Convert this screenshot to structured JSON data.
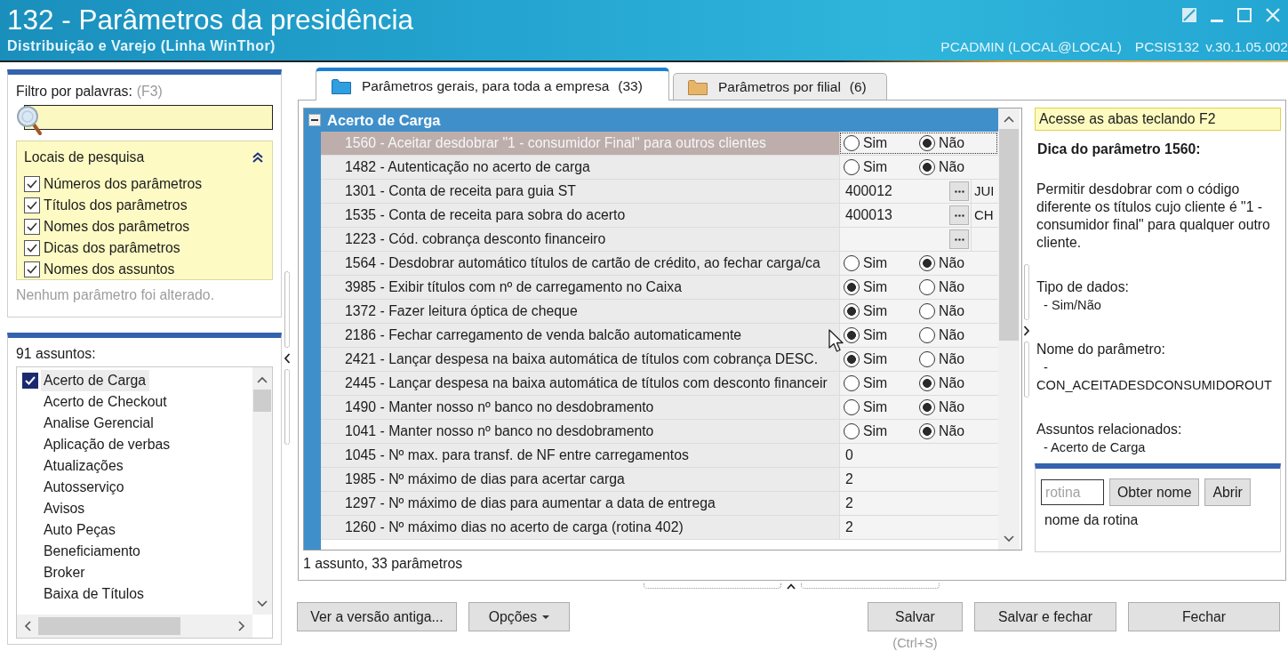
{
  "window": {
    "title": "132 - Parâmetros da presidência",
    "subtitle": "Distribuição e Varejo (Linha WinThor)",
    "user": "PCADMIN (LOCAL@LOCAL)",
    "routine": "PCSIS132",
    "version": "v.30.1.05.002"
  },
  "filter": {
    "label": "Filtro por palavras:",
    "shortcut": "(F3)",
    "search_locations": {
      "title": "Locais de pesquisa",
      "expanded": true,
      "options": [
        {
          "label": "Números dos parâmetros",
          "checked": true
        },
        {
          "label": "Títulos dos parâmetros",
          "checked": true
        },
        {
          "label": "Nomes dos parâmetros",
          "checked": true
        },
        {
          "label": "Dicas dos parâmetros",
          "checked": true
        },
        {
          "label": "Nomes dos assuntos",
          "checked": true
        }
      ]
    },
    "status": "Nenhum parâmetro foi alterado."
  },
  "subjects": {
    "count_label": "91 assuntos:",
    "items": [
      {
        "label": "Acerto de Carga",
        "checked": true,
        "selected": true
      },
      {
        "label": "Acerto de Checkout",
        "checked": false,
        "selected": false
      },
      {
        "label": "Analise Gerencial",
        "checked": false,
        "selected": false
      },
      {
        "label": "Aplicação de verbas",
        "checked": false,
        "selected": false
      },
      {
        "label": "Atualizações",
        "checked": false,
        "selected": false
      },
      {
        "label": "Autosserviço",
        "checked": false,
        "selected": false
      },
      {
        "label": "Avisos",
        "checked": false,
        "selected": false
      },
      {
        "label": "Auto Peças",
        "checked": false,
        "selected": false
      },
      {
        "label": "Beneficiamento",
        "checked": false,
        "selected": false
      },
      {
        "label": "Broker",
        "checked": false,
        "selected": false
      },
      {
        "label": "Baixa de Títulos",
        "checked": false,
        "selected": false
      }
    ]
  },
  "tabs": [
    {
      "label": "Parâmetros gerais, para toda a empresa",
      "count": "(33)",
      "selected": true
    },
    {
      "label": "Parâmetros por filial",
      "count": "(6)",
      "selected": false
    }
  ],
  "grid": {
    "group": {
      "title": "Acerto de Carga",
      "expanded": true
    },
    "rows": [
      {
        "label": "1560 - Aceitar desdobrar \"1 - consumidor Final\" para outros clientes",
        "selected": true,
        "kind": "radio",
        "options": [
          {
            "label": "Sim",
            "selected": false
          },
          {
            "label": "Não",
            "selected": true
          }
        ]
      },
      {
        "label": "1482 - Autenticação no acerto de carga",
        "selected": false,
        "kind": "radio",
        "options": [
          {
            "label": "Sim",
            "selected": false
          },
          {
            "label": "Não",
            "selected": true
          }
        ]
      },
      {
        "label": "1301 - Conta de receita para guia ST",
        "selected": false,
        "kind": "lookup",
        "value": "400012",
        "description": "JUI"
      },
      {
        "label": "1535 - Conta de receita para sobra do acerto",
        "selected": false,
        "kind": "lookup",
        "value": "400013",
        "description": "CH"
      },
      {
        "label": "1223 - Cód. cobrança desconto financeiro",
        "selected": false,
        "kind": "lookup"
      },
      {
        "label": "1564 - Desdobrar automático títulos de cartão de crédito, ao fechar carga/ca",
        "selected": false,
        "kind": "radio",
        "options": [
          {
            "label": "Sim",
            "selected": false
          },
          {
            "label": "Não",
            "selected": true
          }
        ]
      },
      {
        "label": "3985 - Exibir títulos com nº de carregamento no Caixa",
        "selected": false,
        "kind": "radio",
        "options": [
          {
            "label": "Sim",
            "selected": true
          },
          {
            "label": "Não",
            "selected": false
          }
        ]
      },
      {
        "label": "1372 - Fazer leitura óptica de cheque",
        "selected": false,
        "kind": "radio",
        "options": [
          {
            "label": "Sim",
            "selected": true
          },
          {
            "label": "Não",
            "selected": false
          }
        ]
      },
      {
        "label": "2186 - Fechar carregamento de venda balcão automaticamente",
        "selected": false,
        "kind": "radio",
        "options": [
          {
            "label": "Sim",
            "selected": true
          },
          {
            "label": "Não",
            "selected": false
          }
        ]
      },
      {
        "label": "2421 - Lançar despesa na baixa automática de títulos com cobrança DESC.",
        "selected": false,
        "kind": "radio",
        "options": [
          {
            "label": "Sim",
            "selected": true
          },
          {
            "label": "Não",
            "selected": false
          }
        ]
      },
      {
        "label": "2445 - Lançar despesa na baixa automática de títulos com desconto financeir",
        "selected": false,
        "kind": "radio",
        "options": [
          {
            "label": "Sim",
            "selected": false
          },
          {
            "label": "Não",
            "selected": true
          }
        ]
      },
      {
        "label": "1490 - Manter nosso nº banco no desdobramento",
        "selected": false,
        "kind": "radio",
        "options": [
          {
            "label": "Sim",
            "selected": false
          },
          {
            "label": "Não",
            "selected": true
          }
        ]
      },
      {
        "label": "1041 - Manter nosso nº banco no desdobramento",
        "selected": false,
        "kind": "radio",
        "options": [
          {
            "label": "Sim",
            "selected": false
          },
          {
            "label": "Não",
            "selected": true
          }
        ]
      },
      {
        "label": "1045 - Nº max. para transf. de NF entre carregamentos",
        "selected": false,
        "kind": "number",
        "value": "0"
      },
      {
        "label": "1985 - Nº máximo de dias para acertar carga",
        "selected": false,
        "kind": "number",
        "value": "2"
      },
      {
        "label": "1297 - Nº máximo de dias para aumentar a data de entrega",
        "selected": false,
        "kind": "number",
        "value": "2"
      },
      {
        "label": "1260 - Nº máximo dias no acerto de carga (rotina 402)",
        "selected": false,
        "kind": "number",
        "value": "2"
      }
    ],
    "summary": "1 assunto, 33 parâmetros"
  },
  "help": {
    "tip": "Acesse as abas teclando F2",
    "heading": "Dica do parâmetro 1560:",
    "description": "Permitir desdobrar com o código diferente os títulos cujo cliente é \"1 - consumidor final\" para qualquer outro cliente.",
    "sections": [
      {
        "title": "Tipo de dados:",
        "value": "- Sim/Não"
      },
      {
        "title": "Nome do parâmetro:",
        "value": "- CON_ACEITADESDCONSUMIDOROUT"
      },
      {
        "title": "Assuntos relacionados:",
        "value": "- Acerto de Carga"
      }
    ]
  },
  "routine_lookup": {
    "placeholder": "rotina",
    "buttons": [
      "Obter nome",
      "Abrir"
    ],
    "result": "nome da rotina"
  },
  "actions": {
    "left": [
      {
        "label": "Ver a versão antiga...",
        "kind": "plain"
      },
      {
        "label": "Opções",
        "kind": "menu"
      }
    ],
    "right": [
      {
        "label": "Salvar",
        "kind": "plain",
        "hint": "(Ctrl+S)"
      },
      {
        "label": "Salvar e fechar",
        "kind": "plain"
      },
      {
        "label": "Fechar",
        "kind": "plain"
      }
    ]
  }
}
